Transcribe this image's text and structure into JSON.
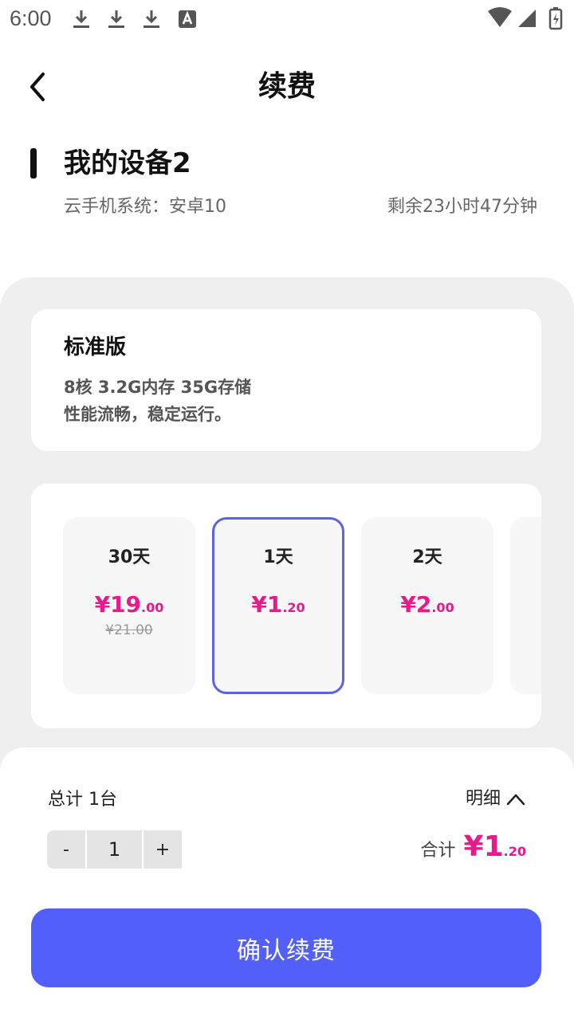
{
  "status_bar": {
    "time": "6:00",
    "icons": [
      "download-icon",
      "download-icon",
      "download-icon",
      "text-a-icon",
      "wifi-icon",
      "signal-icon",
      "battery-charging-icon"
    ]
  },
  "header": {
    "title": "续费",
    "back_icon": "chevron-left-icon"
  },
  "device": {
    "name": "我的设备2",
    "system": "云手机系统：安卓10",
    "remaining": "剩余23小时47分钟"
  },
  "plan": {
    "name": "标准版",
    "spec": "8核 3.2G内存 35G存储",
    "desc": "性能流畅，稳定运行。"
  },
  "options": [
    {
      "days": "30天",
      "price_main": "¥19",
      "price_dec": ".00",
      "original": "¥21.00",
      "selected": false
    },
    {
      "days": "1天",
      "price_main": "¥1",
      "price_dec": ".20",
      "original": "",
      "selected": true
    },
    {
      "days": "2天",
      "price_main": "¥2",
      "price_dec": ".00",
      "original": "",
      "selected": false
    }
  ],
  "summary": {
    "total_count": "总计 1台",
    "detail_label": "明细",
    "detail_icon": "chevron-up-icon",
    "stepper_minus": "-",
    "stepper_value": "1",
    "stepper_plus": "+",
    "sum_label": "合计",
    "sum_main": "¥1",
    "sum_dec": ".20"
  },
  "confirm_label": "确认续费",
  "colors": {
    "accent": "#525ff8",
    "price": "#e8198b",
    "selected_border": "#5a63e8",
    "panel_bg": "#efefef"
  }
}
